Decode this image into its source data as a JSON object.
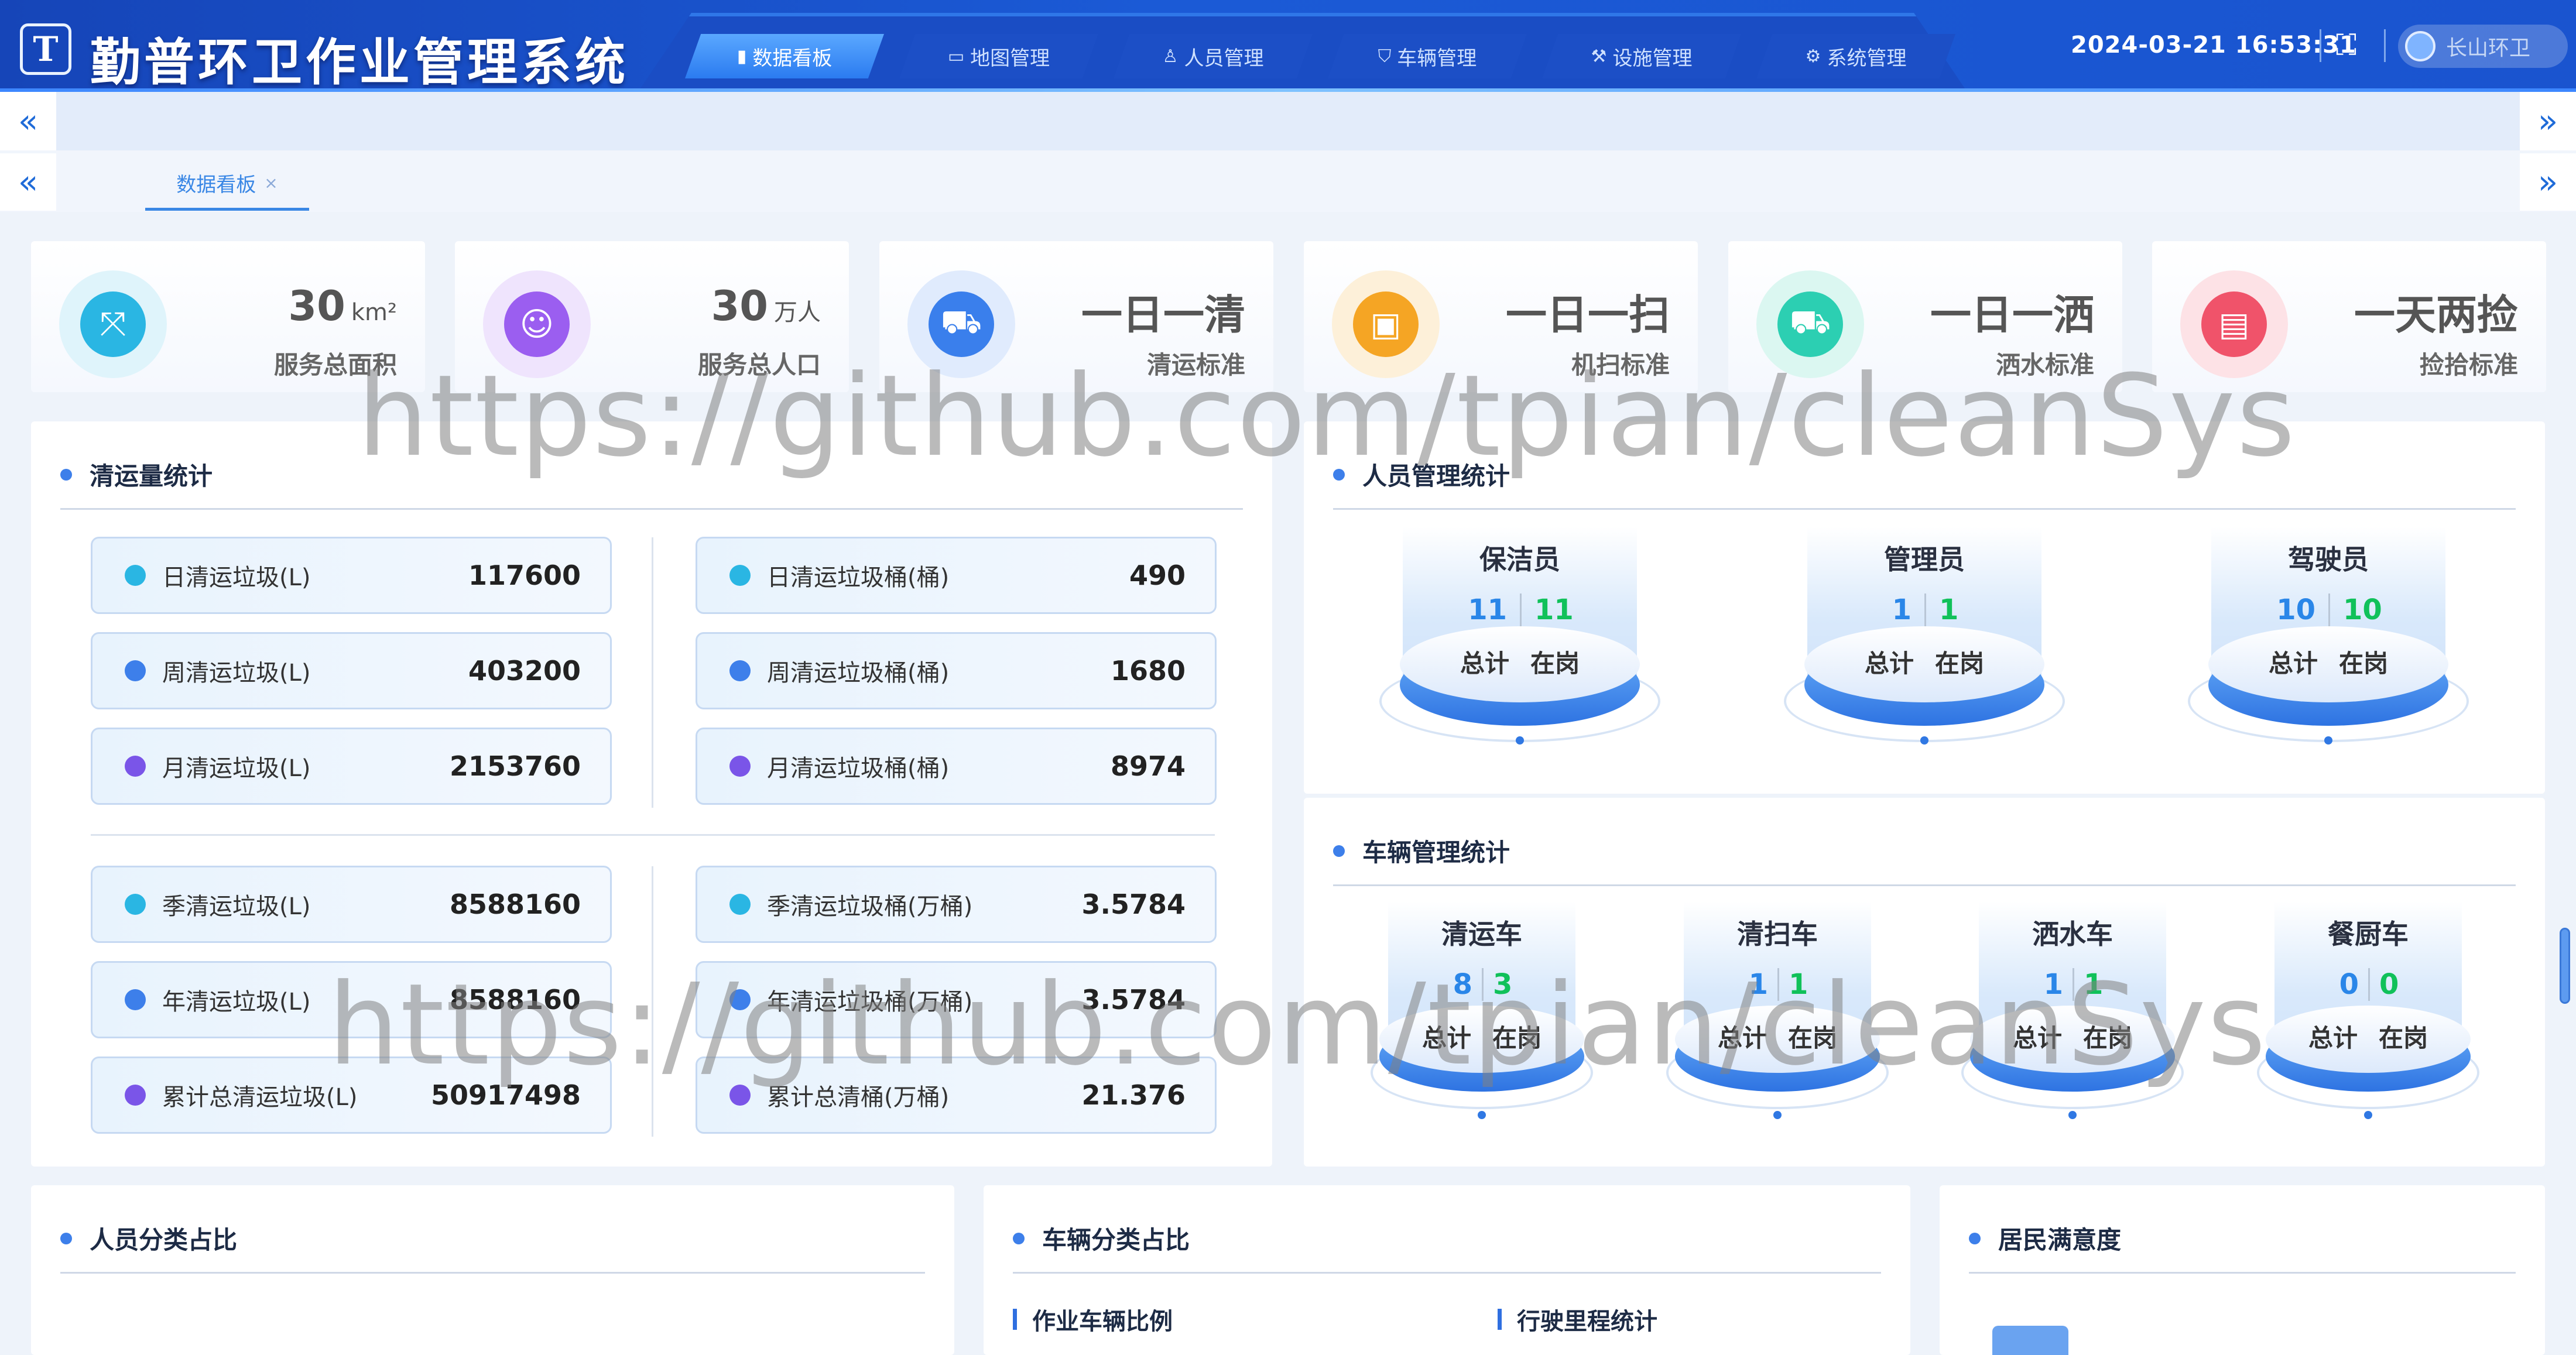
{
  "header": {
    "logo_letter": "T",
    "title": "勤普环卫作业管理系统",
    "datetime": "2024-03-21 16:53:31",
    "user": "长山环卫",
    "nav": [
      {
        "label": "数据看板",
        "icon": "chart-bar-icon",
        "glyph": "▮",
        "active": true
      },
      {
        "label": "地图管理",
        "icon": "monitor-icon",
        "glyph": "▭",
        "active": false
      },
      {
        "label": "人员管理",
        "icon": "user-icon",
        "glyph": "♙",
        "active": false
      },
      {
        "label": "车辆管理",
        "icon": "shield-icon",
        "glyph": "⛉",
        "active": false
      },
      {
        "label": "设施管理",
        "icon": "wrench-icon",
        "glyph": "⚒",
        "active": false
      },
      {
        "label": "系统管理",
        "icon": "gear-icon",
        "glyph": "⚙",
        "active": false
      }
    ]
  },
  "tabs": [
    {
      "label": "数据看板",
      "close": "×"
    }
  ],
  "stats": [
    {
      "value": "30",
      "unit": "km²",
      "label": "服务总面积",
      "icon": "area-icon",
      "glyph": "⤧",
      "color": "#2ab6e3",
      "bg": "#dff4fb"
    },
    {
      "value": "30",
      "unit": "万人",
      "label": "服务总人口",
      "icon": "person-card-icon",
      "glyph": "☺",
      "color": "#9b5ef0",
      "bg": "#efe4fd"
    },
    {
      "value": "一日一清",
      "unit": "",
      "label": "清运标准",
      "icon": "garbage-truck-icon",
      "glyph": "⛟",
      "color": "#3a7fec",
      "bg": "#e0ebfd"
    },
    {
      "value": "一日一扫",
      "unit": "",
      "label": "机扫标准",
      "icon": "sweeper-icon",
      "glyph": "▣",
      "color": "#f5a524",
      "bg": "#fdf0d9"
    },
    {
      "value": "一日一洒",
      "unit": "",
      "label": "洒水标准",
      "icon": "water-truck-icon",
      "glyph": "⛟",
      "color": "#2ccfb2",
      "bg": "#dbf7f1"
    },
    {
      "value": "一天两捡",
      "unit": "",
      "label": "捡拾标准",
      "icon": "pickup-basket-icon",
      "glyph": "▤",
      "color": "#f0536a",
      "bg": "#fde2e6"
    }
  ],
  "haul": {
    "title": "清运量统计",
    "left_top": [
      {
        "name": "日清运垃圾(L)",
        "value": "117600",
        "color": "#2ab6e3"
      },
      {
        "name": "周清运垃圾(L)",
        "value": "403200",
        "color": "#3d7fea"
      },
      {
        "name": "月清运垃圾(L)",
        "value": "2153760",
        "color": "#7a55e8"
      }
    ],
    "right_top": [
      {
        "name": "日清运垃圾桶(桶)",
        "value": "490",
        "color": "#2ab6e3"
      },
      {
        "name": "周清运垃圾桶(桶)",
        "value": "1680",
        "color": "#3d7fea"
      },
      {
        "name": "月清运垃圾桶(桶)",
        "value": "8974",
        "color": "#7a55e8"
      }
    ],
    "left_bottom": [
      {
        "name": "季清运垃圾(L)",
        "value": "8588160",
        "color": "#2ab6e3"
      },
      {
        "name": "年清运垃圾(L)",
        "value": "8588160",
        "color": "#3d7fea"
      },
      {
        "name": "累计总清运垃圾(L)",
        "value": "50917498",
        "color": "#7a55e8"
      }
    ],
    "right_bottom": [
      {
        "name": "季清运垃圾桶(万桶)",
        "value": "3.5784",
        "color": "#2ab6e3"
      },
      {
        "name": "年清运垃圾桶(万桶)",
        "value": "3.5784",
        "color": "#3d7fea"
      },
      {
        "name": "累计总清桶(万桶)",
        "value": "21.376",
        "color": "#7a55e8"
      }
    ]
  },
  "staff": {
    "title": "人员管理统计",
    "total_label": "总计",
    "on_duty_label": "在岗",
    "items": [
      {
        "name": "保洁员",
        "total": "11",
        "on_duty": "11"
      },
      {
        "name": "管理员",
        "total": "1",
        "on_duty": "1"
      },
      {
        "name": "驾驶员",
        "total": "10",
        "on_duty": "10"
      }
    ]
  },
  "vehicles": {
    "title": "车辆管理统计",
    "total_label": "总计",
    "on_duty_label": "在岗",
    "items": [
      {
        "name": "清运车",
        "total": "8",
        "on_duty": "3"
      },
      {
        "name": "清扫车",
        "total": "1",
        "on_duty": "1"
      },
      {
        "name": "洒水车",
        "total": "1",
        "on_duty": "1"
      },
      {
        "name": "餐厨车",
        "total": "0",
        "on_duty": "0"
      }
    ]
  },
  "bottom": {
    "staff_ratio_title": "人员分类占比",
    "vehicle_ratio_title": "车辆分类占比",
    "satisfaction_title": "居民满意度",
    "work_vehicle_ratio": "作业车辆比例",
    "mileage_stats": "行驶里程统计"
  },
  "watermark": "https://github.com/tpian/cleanSys"
}
